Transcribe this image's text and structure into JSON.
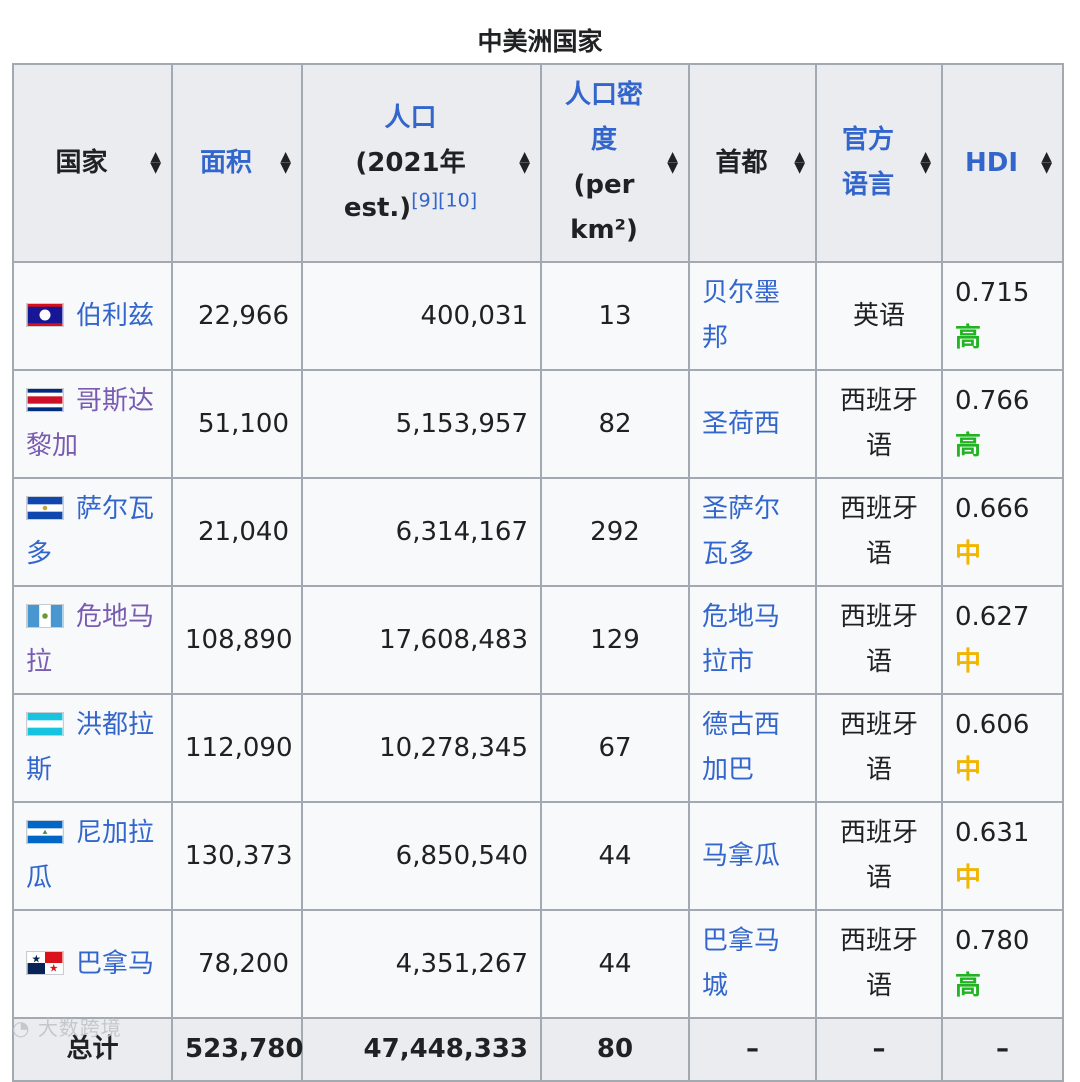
{
  "caption": "中美洲国家",
  "headers": {
    "country": "国家",
    "area": "面积",
    "population_a": "人口",
    "population_b": "(2021年",
    "population_c": "est.)",
    "population_ref1": "[9]",
    "population_ref2": "[10]",
    "density_a": "人口密",
    "density_b": "度",
    "density_c": "(per",
    "density_d": "km²)",
    "capital": "首都",
    "language_a": "官方",
    "language_b": "语言",
    "hdi": "HDI"
  },
  "rows": [
    {
      "country": "伯利兹",
      "area": "22,966",
      "population": "400,031",
      "density": "13",
      "capital": "贝尔墨邦",
      "language": "英语",
      "hdi": "0.715",
      "hdi_level": "高"
    },
    {
      "country": "哥斯达黎加",
      "area": "51,100",
      "population": "5,153,957",
      "density": "82",
      "capital": "圣荷西",
      "language": "西班牙语",
      "hdi": "0.766",
      "hdi_level": "高"
    },
    {
      "country": "萨尔瓦多",
      "area": "21,040",
      "population": "6,314,167",
      "density": "292",
      "capital": "圣萨尔瓦多",
      "language": "西班牙语",
      "hdi": "0.666",
      "hdi_level": "中"
    },
    {
      "country": "危地马拉",
      "area": "108,890",
      "population": "17,608,483",
      "density": "129",
      "capital": "危地马拉市",
      "language": "西班牙语",
      "hdi": "0.627",
      "hdi_level": "中"
    },
    {
      "country": "洪都拉斯",
      "area": "112,090",
      "population": "10,278,345",
      "density": "67",
      "capital": "德古西加巴",
      "language": "西班牙语",
      "hdi": "0.606",
      "hdi_level": "中"
    },
    {
      "country": "尼加拉瓜",
      "area": "130,373",
      "population": "6,850,540",
      "density": "44",
      "capital": "马拿瓜",
      "language": "西班牙语",
      "hdi": "0.631",
      "hdi_level": "中"
    },
    {
      "country": "巴拿马",
      "area": "78,200",
      "population": "4,351,267",
      "density": "44",
      "capital": "巴拿马城",
      "language": "西班牙语",
      "hdi": "0.780",
      "hdi_level": "高"
    }
  ],
  "total": {
    "label": "总计",
    "area": "523,780",
    "population": "47,448,333",
    "density": "80",
    "capital": "–",
    "language": "–",
    "hdi": "–"
  },
  "sort_icon": "sort-arrows-icon",
  "watermark": "大数跨境",
  "colors": {
    "link": "#3366cc",
    "visited": "#795cb2",
    "hdi_high": "#22b322",
    "hdi_mid": "#f2b600",
    "header_bg": "#eaecf0",
    "border": "#a2a9b1"
  }
}
